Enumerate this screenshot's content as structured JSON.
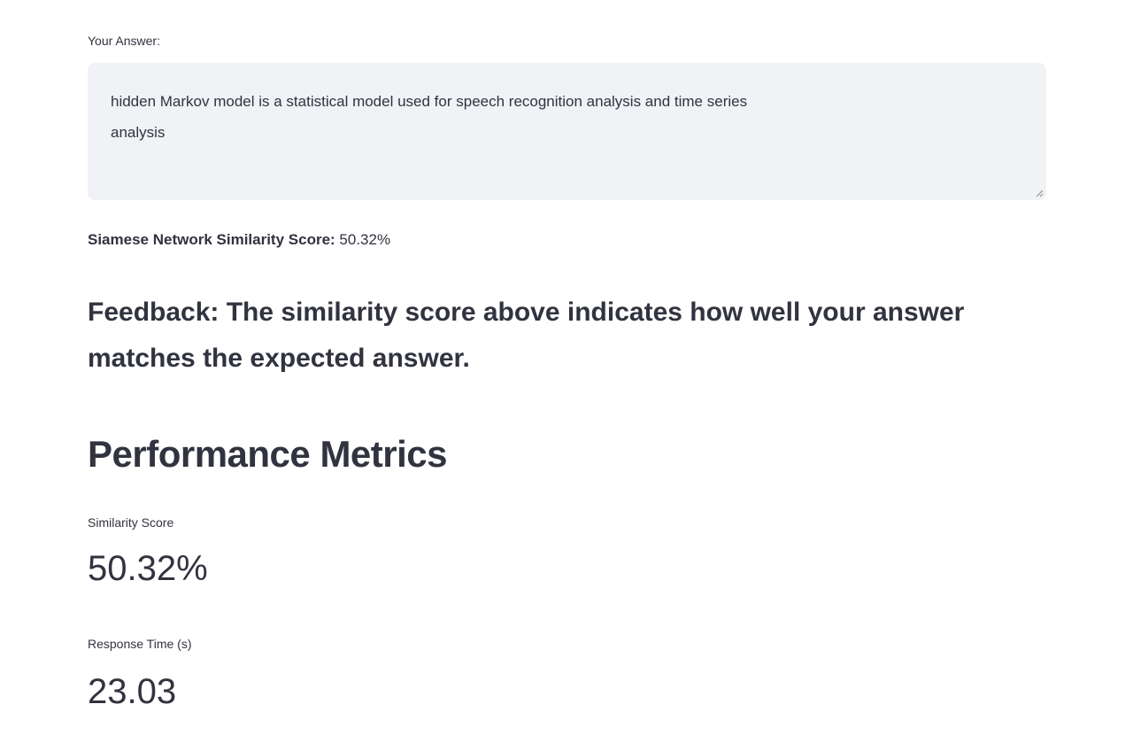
{
  "answer_input": {
    "label": "Your Answer:",
    "value": "hidden Markov model is a statistical model used for speech recognition analysis and time series\nanalysis"
  },
  "similarity_line": {
    "label": "Siamese Network Similarity Score:",
    "value": "50.32%"
  },
  "feedback": {
    "heading": "Feedback: The similarity score above indicates how well your answer matches the expected answer."
  },
  "performance": {
    "title": "Performance Metrics",
    "metrics": [
      {
        "label": "Similarity Score",
        "value": "50.32%"
      },
      {
        "label": "Response Time (s)",
        "value": "23.03"
      }
    ]
  },
  "colors": {
    "text": "#31333f",
    "input_bg": "#f0f2f6"
  }
}
